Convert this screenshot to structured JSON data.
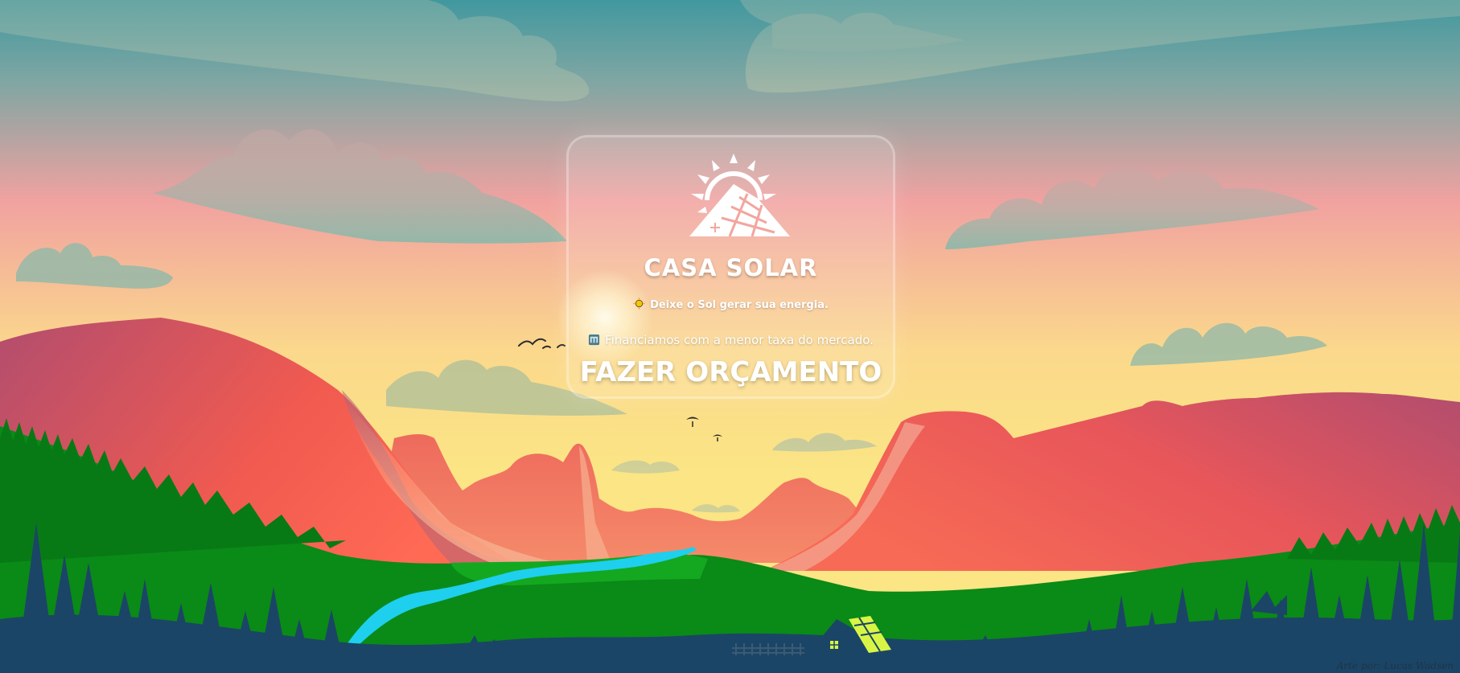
{
  "brand": {
    "name": "CASA SOLAR",
    "logo_icon": "sun-house-solar-roof-icon"
  },
  "taglines": [
    {
      "icon": "sun-icon",
      "text": "Deixe o Sol gerar sua energia."
    },
    {
      "icon": "bank-icon",
      "text": "Financiamos com a menor taxa do mercado."
    }
  ],
  "cta": {
    "label": "FAZER ORÇAMENTO"
  },
  "credit": "Arte por: Lucas Wadsen",
  "colors": {
    "sky_top": "#4a9ea3",
    "sky_mid": "#f2a5a0",
    "sky_low": "#fbe583",
    "mountain_red": "#e85a4f",
    "grass_green": "#11921a",
    "tree_navy": "#1b4566",
    "river": "#28d3f0",
    "roof_panel": "#d8f545"
  }
}
